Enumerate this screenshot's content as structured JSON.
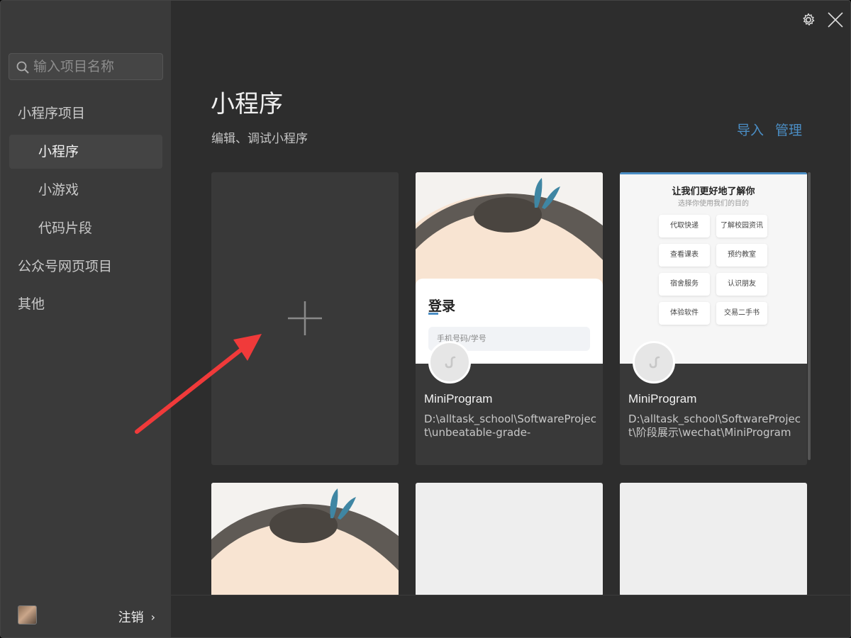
{
  "search": {
    "placeholder": "输入项目名称"
  },
  "sidebar": {
    "items": [
      {
        "label": "小程序项目"
      },
      {
        "label": "小程序"
      },
      {
        "label": "小游戏"
      },
      {
        "label": "代码片段"
      },
      {
        "label": "公众号网页项目"
      },
      {
        "label": "其他"
      }
    ],
    "logout_label": "注销",
    "logout_chevron": "›"
  },
  "main": {
    "title": "小程序",
    "subtitle": "编辑、调试小程序",
    "import_label": "导入",
    "manage_label": "管理"
  },
  "projects": [
    {
      "name": "MiniProgram",
      "path": "D:\\alltask_school\\SoftwareProject\\unbeatable-grade-",
      "preview": {
        "login_title": "登录",
        "input_placeholder": "手机号码/学号"
      }
    },
    {
      "name": "MiniProgram",
      "path": "D:\\alltask_school\\SoftwareProject\\阶段展示\\wechat\\MiniProgram",
      "preview": {
        "heading": "让我们更好地了解你",
        "sub": "选择你使用我们的目的",
        "options": [
          "代取快递",
          "了解校园资讯",
          "查看课表",
          "预约教室",
          "宿舍服务",
          "认识朋友",
          "体验软件",
          "交易二手书"
        ]
      }
    }
  ],
  "colors": {
    "accent": "#4b8ec5",
    "arrow": "#f03a3a"
  }
}
